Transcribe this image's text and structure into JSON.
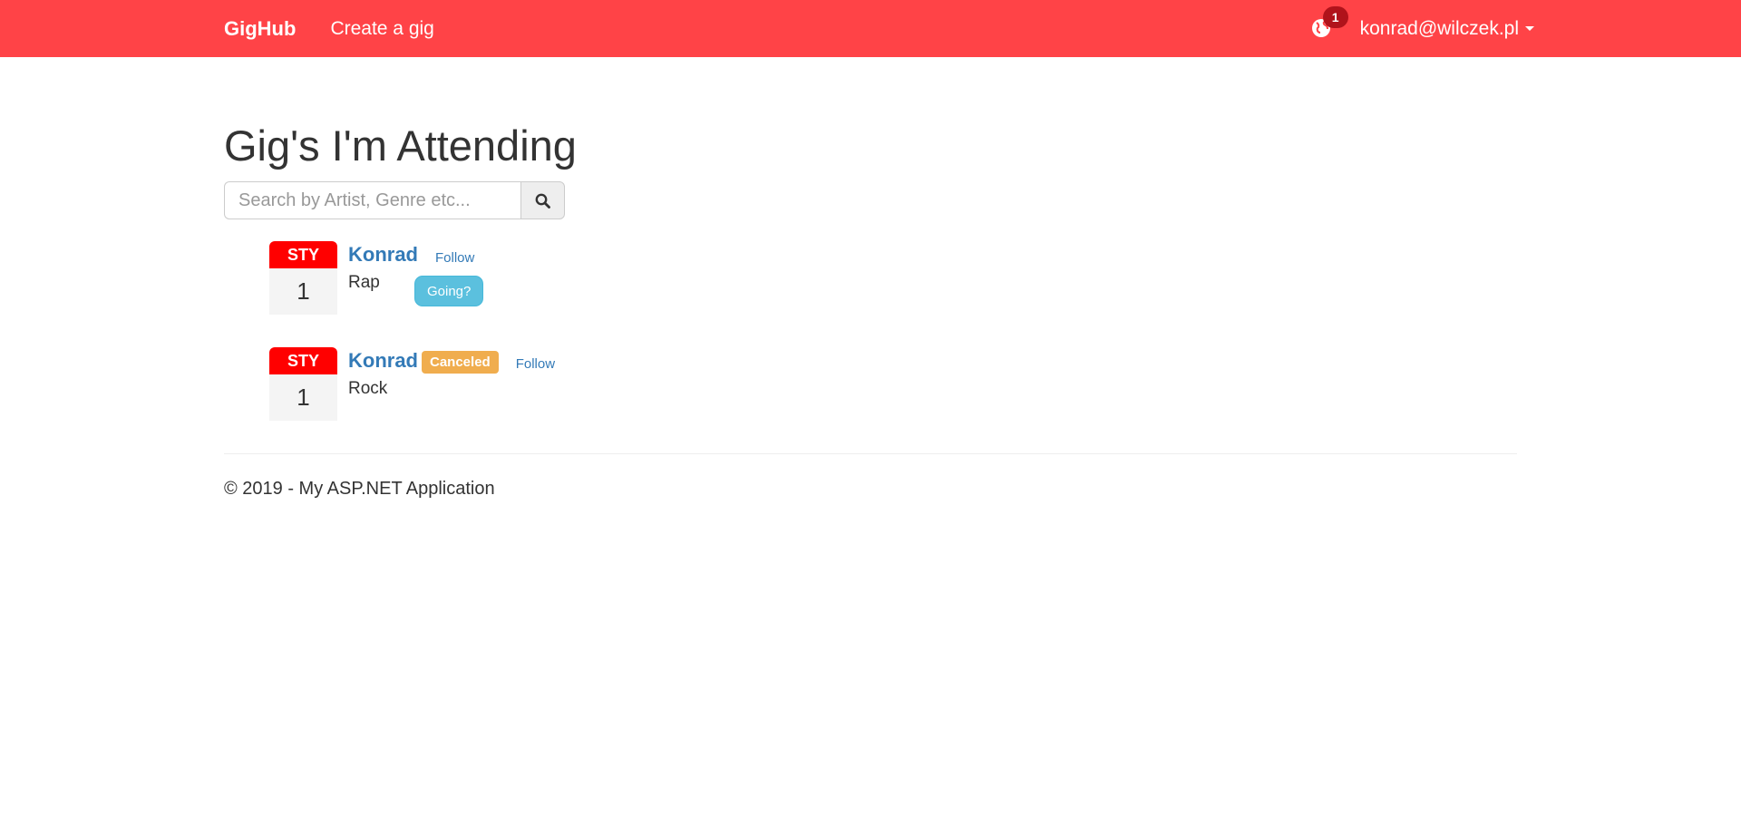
{
  "nav": {
    "brand": "GigHub",
    "create_link": "Create a gig",
    "notifications_count": "1",
    "user": "konrad@wilczek.pl"
  },
  "page": {
    "title": "Gig's I'm Attending",
    "search_placeholder": "Search by Artist, Genre etc..."
  },
  "gigs": [
    {
      "month": "STY",
      "day": "1",
      "artist": "Konrad",
      "follow": "Follow",
      "genre": "Rap",
      "going": "Going?"
    },
    {
      "month": "STY",
      "day": "1",
      "artist": "Konrad",
      "status": "Canceled",
      "follow": "Follow",
      "genre": "Rock"
    }
  ],
  "footer": {
    "text": "© 2019 - My ASP.NET Application"
  },
  "colors": {
    "navbar": "#ff4347",
    "month": "#ff0000",
    "link": "#337ab7",
    "canceled": "#f0ad4e",
    "going": "#5bc0de"
  },
  "icons": {
    "notifications": "globe-icon",
    "search": "search-icon",
    "dropdown": "caret-down-icon"
  }
}
